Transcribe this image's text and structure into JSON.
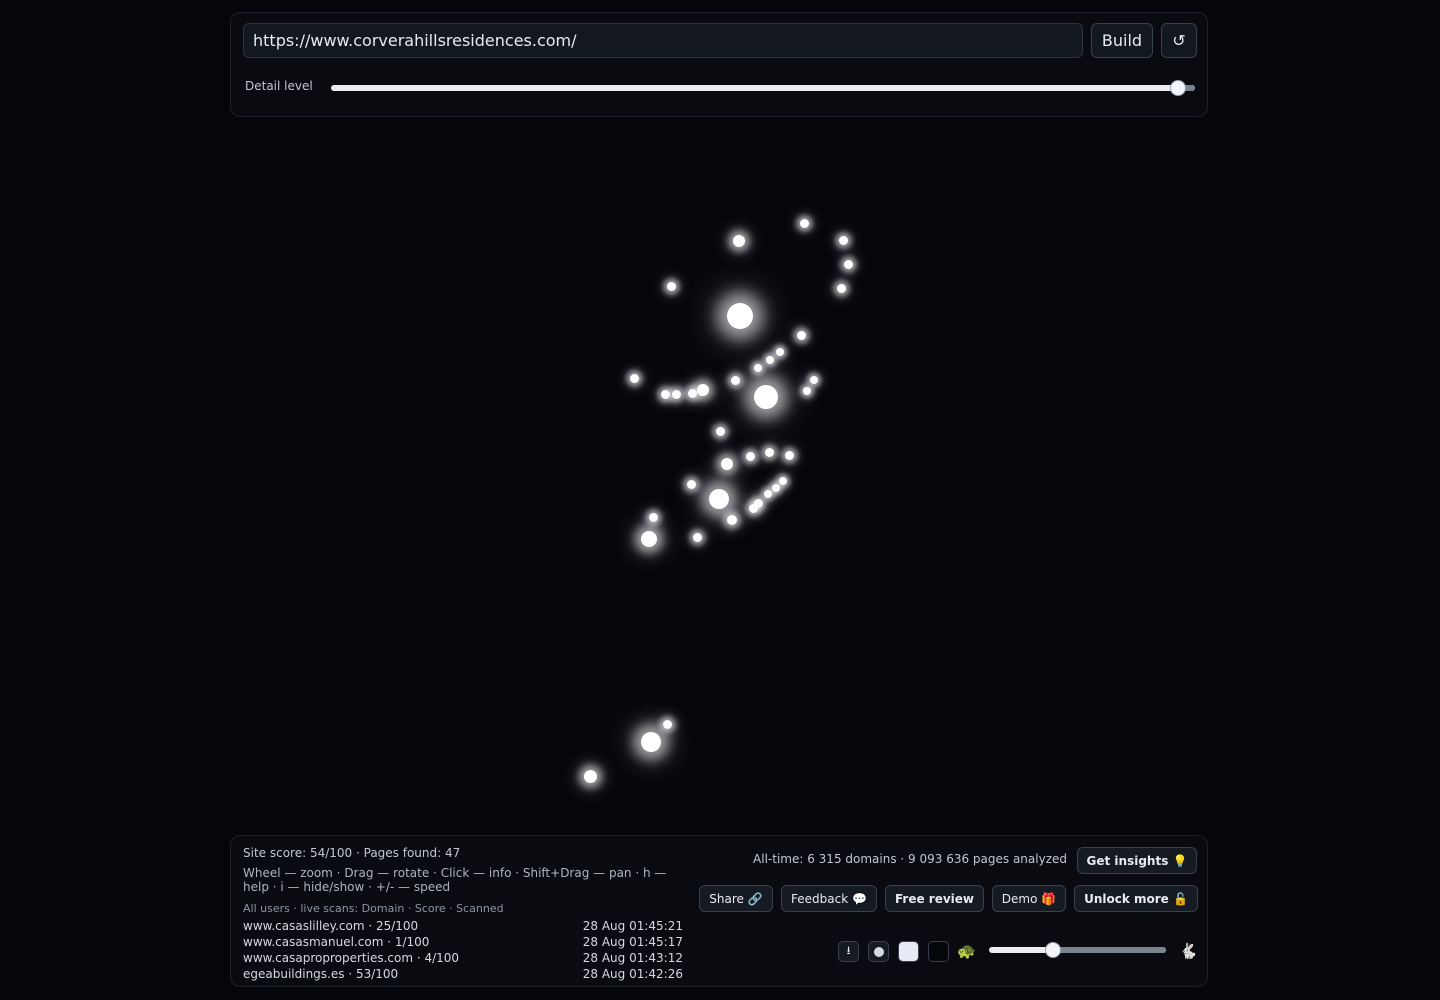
{
  "toolbar": {
    "url_value": "https://www.corverahillsresidences.com/",
    "build_label": "Build",
    "reload_label": "↺",
    "detail_label": "Detail level",
    "detail_value": 0.98
  },
  "graph": {
    "node_count_label": ""
  },
  "panel": {
    "site_score": "Site score: 54/100 · Pages found: 47",
    "help": "Wheel — zoom · Drag — rotate · Click — info · Shift+Drag — pan · h — help · i — hide/show · +/- — speed",
    "scans_header": "All users · live scans: Domain · Score · Scanned",
    "scans": [
      {
        "domain": "www.casaslilley.com · 25/100",
        "time": "28 Aug 01:45:21"
      },
      {
        "domain": "www.casasmanuel.com · 1/100",
        "time": "28 Aug 01:45:17"
      },
      {
        "domain": "www.casaproproperties.com · 4/100",
        "time": "28 Aug 01:43:12"
      },
      {
        "domain": "egeabuildings.es · 53/100",
        "time": "28 Aug 01:42:26"
      }
    ],
    "alltime": "All-time: 6 315 domains · 9 093 636 pages analyzed",
    "insights_label": "Get insights 💡",
    "share_label": "Share 🔗",
    "feedback_label": "Feedback 💬",
    "review_label": "Free review",
    "demo_label": "Demo 🎁",
    "unlock_label": "Unlock more 🔓",
    "download_icon": "⭳",
    "slow_icon": "🐢",
    "fast_icon": "🐇",
    "speed_value": 0.36
  }
}
